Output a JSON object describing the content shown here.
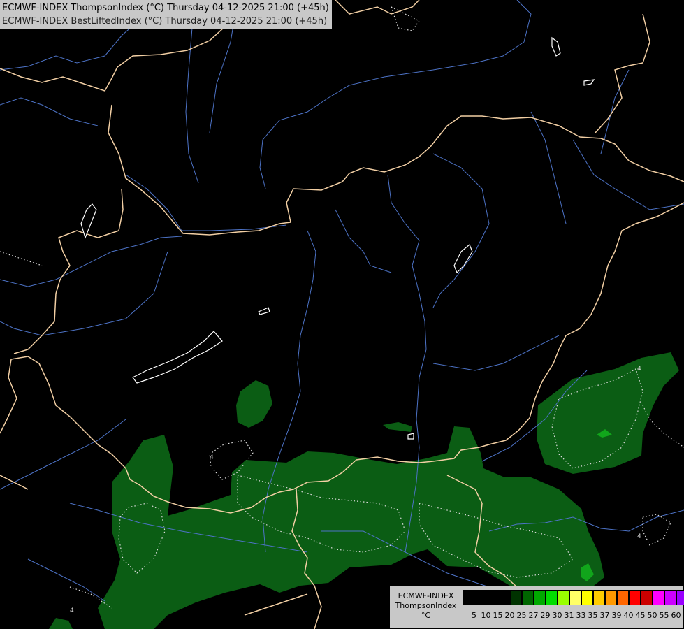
{
  "header": {
    "title_line1": "ECMWF-INDEX ThompsonIndex (°C) Thursday 04-12-2025 21:00 (+45h)",
    "title_line2": "ECMWF-INDEX BestLiftedIndex (°C) Thursday 04-12-2025 21:00 (+45h)"
  },
  "legend": {
    "line1": "ECMWF-INDEX",
    "line2": "ThompsonIndex",
    "line3": "°C",
    "colors": [
      "#000000",
      "#000000",
      "#000000",
      "#000000",
      "#003300",
      "#006600",
      "#00aa00",
      "#00dd00",
      "#99ff00",
      "#ffff66",
      "#ffff00",
      "#ffcc00",
      "#ff9900",
      "#ff6600",
      "#ff0000",
      "#cc0000",
      "#ff00ff",
      "#cc00ff",
      "#9900ff",
      "#6600ff",
      "#0000ff"
    ],
    "ticks": [
      "5",
      "10",
      "15",
      "20",
      "25",
      "27",
      "29",
      "30",
      "31",
      "33",
      "35",
      "37",
      "39",
      "40",
      "45",
      "50",
      "55",
      "60"
    ]
  },
  "contour_labels": [
    "4",
    "4",
    "4",
    "4"
  ],
  "colors": {
    "green_field": "#0b5d14",
    "bright_green": "#11a51b",
    "border": "#f2cfa4",
    "river": "#4d73c7",
    "lake": "#ffffff"
  }
}
